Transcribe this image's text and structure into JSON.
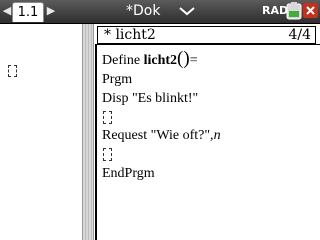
{
  "titlebar": {
    "tab_label": "1.1",
    "document_title": "*Dok",
    "angle_mode": "RAD",
    "nav_left_icon": "triangle-left-icon",
    "nav_right_icon": "triangle-right-icon",
    "doc_menu_icon": "chevron-down-icon",
    "battery_icon": "battery-icon",
    "close_icon": "close-icon"
  },
  "editor": {
    "program_name": "* licht2",
    "line_position": "4/4",
    "lines": {
      "define_keyword": "Define ",
      "program_name": "licht2",
      "parens": "()",
      "equals": "=",
      "prgm": "Prgm",
      "disp": "Disp \"Es blinkt!\"",
      "request": "Request \"Wie oft?\",",
      "request_var": "n",
      "endprgm": "EndPrgm"
    }
  },
  "colors": {
    "titlebar_dark": "#2e2e2e",
    "close_button": "#c2301e",
    "divider": "#d8d8d8"
  }
}
